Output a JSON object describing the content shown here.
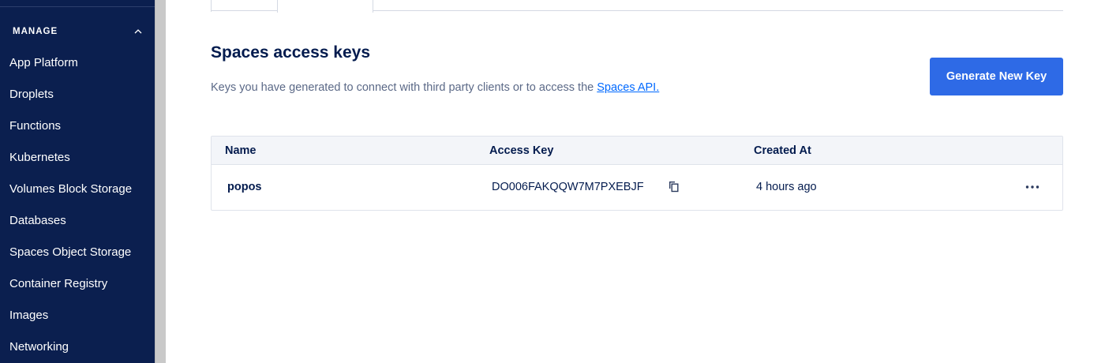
{
  "sidebar": {
    "section_title": "MANAGE",
    "items": [
      {
        "label": "App Platform"
      },
      {
        "label": "Droplets"
      },
      {
        "label": "Functions"
      },
      {
        "label": "Kubernetes"
      },
      {
        "label": "Volumes Block Storage"
      },
      {
        "label": "Databases"
      },
      {
        "label": "Spaces Object Storage"
      },
      {
        "label": "Container Registry"
      },
      {
        "label": "Images"
      },
      {
        "label": "Networking"
      }
    ]
  },
  "main": {
    "title": "Spaces access keys",
    "description_prefix": "Keys you have generated to connect with third party clients or to access the ",
    "description_link": "Spaces API.",
    "generate_button": "Generate New Key",
    "table": {
      "columns": [
        "Name",
        "Access Key",
        "Created At"
      ],
      "rows": [
        {
          "name": "popos",
          "access_key": "DO006FAKQQW7M7PXEBJF",
          "created_at": "4 hours ago"
        }
      ]
    }
  },
  "colors": {
    "sidebar_bg": "#0b1f4f",
    "primary": "#2e6ae6",
    "link": "#0069ff",
    "heading": "#031b4e"
  },
  "icons": {
    "section_toggle": "chevron-up-icon",
    "copy": "copy-icon",
    "row_menu": "more-horizontal-icon"
  }
}
